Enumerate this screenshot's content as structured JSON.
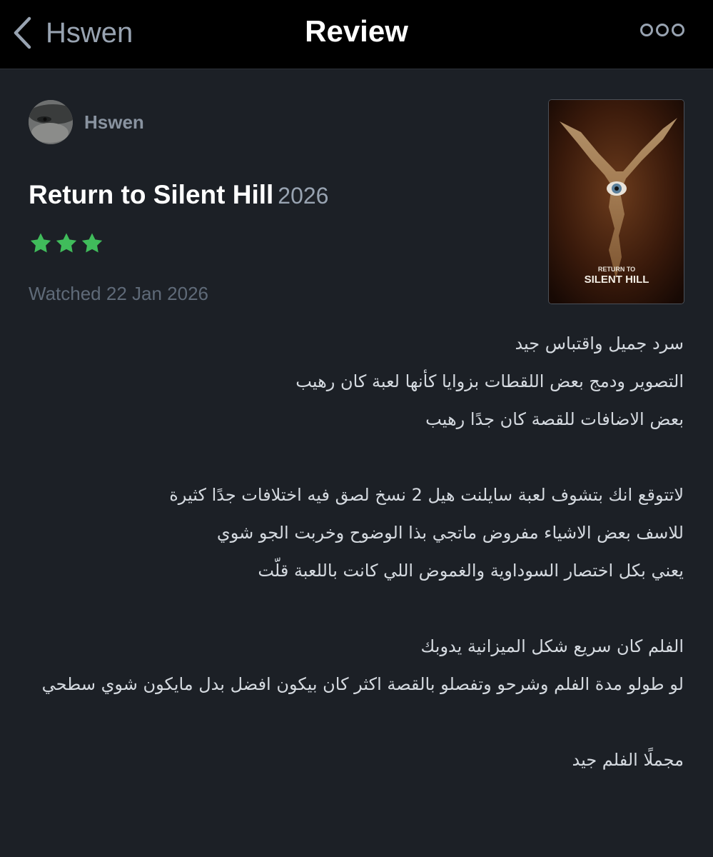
{
  "topbar": {
    "back_label": "Hswen",
    "title": "Review"
  },
  "review": {
    "author": "Hswen",
    "film_title": "Return to Silent Hill",
    "film_year": "2026",
    "rating_stars": 3,
    "watched": "Watched 22 Jan 2026",
    "poster_text": [
      "RETURN TO",
      "SILENT HILL"
    ],
    "paragraphs": [
      [
        "سرد جميل واقتباس جيد",
        "التصوير ودمج بعض اللقطات بزوايا كأنها لعبة كان رهيب",
        "بعض الاضافات للقصة كان جدًا رهيب"
      ],
      [
        "لاتتوقع انك بتشوف لعبة سايلنت هيل 2 نسخ لصق فيه اختلافات جدًا كثيرة",
        "للاسف بعض الاشياء مفروض ماتجي بذا الوضوح وخربت الجو شوي",
        "يعني بكل اختصار السوداوية والغموض اللي كانت باللعبة قلّت"
      ],
      [
        "الفلم كان سريع شكل الميزانية يدوبك",
        "لو طولو مدة الفلم وشرحو وتفصلو بالقصة اكثر كان بيكون افضل بدل مايكون شوي سطحي"
      ],
      [
        "مجملًا الفلم جيد"
      ]
    ]
  },
  "colors": {
    "background": "#1c2026",
    "topbar": "#000000",
    "star": "#40bc5b",
    "muted_text": "#98a3b1",
    "body_text": "#d5dae0"
  },
  "icons": {
    "back": "chevron-left-icon",
    "more": "more-dots-icon",
    "star": "star-icon"
  }
}
